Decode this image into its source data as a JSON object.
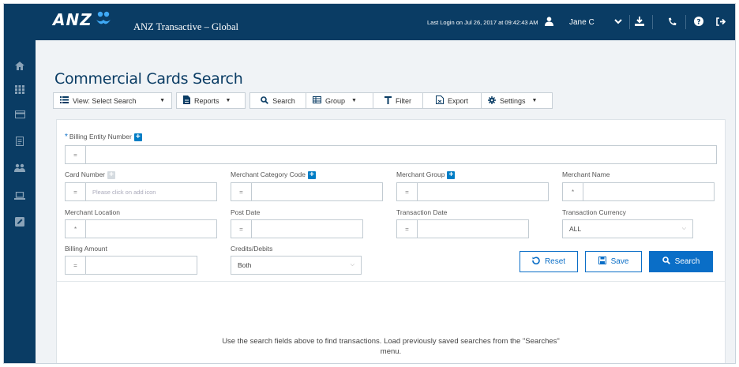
{
  "header": {
    "logo_text": "ANZ",
    "app_title": "ANZ Transactive – Global",
    "last_login": "Last Login on Jul 26, 2017 at 09:42:43 AM",
    "user_name": "Jane C"
  },
  "sidebar": {
    "items": [
      {
        "icon": "home-icon"
      },
      {
        "icon": "grid-icon"
      },
      {
        "icon": "card-icon"
      },
      {
        "icon": "document-icon"
      },
      {
        "icon": "users-icon"
      },
      {
        "icon": "laptop-icon"
      },
      {
        "icon": "edit-icon"
      }
    ]
  },
  "page": {
    "title": "Commercial Cards Search"
  },
  "toolbar": {
    "view_label": "View: Select Search",
    "reports_label": "Reports",
    "search_label": "Search",
    "group_label": "Group",
    "filter_label": "Filter",
    "export_label": "Export",
    "settings_label": "Settings"
  },
  "form": {
    "billing_entity_number_label": "Billing Entity Number",
    "billing_entity_number_op": "=",
    "card_number_label": "Card Number",
    "card_number_op": "=",
    "card_number_placeholder": "Please click on add icon",
    "merchant_category_code_label": "Merchant Category Code",
    "merchant_category_code_op": "=",
    "merchant_group_label": "Merchant Group",
    "merchant_group_op": "=",
    "merchant_name_label": "Merchant Name",
    "merchant_name_op": "*",
    "merchant_location_label": "Merchant Location",
    "merchant_location_op": "*",
    "post_date_label": "Post Date",
    "post_date_op": "=",
    "transaction_date_label": "Transaction Date",
    "transaction_date_op": "=",
    "transaction_currency_label": "Transaction Currency",
    "transaction_currency_value": "ALL",
    "billing_amount_label": "Billing Amount",
    "billing_amount_op": "=",
    "credits_debits_label": "Credits/Debits",
    "credits_debits_value": "Both"
  },
  "actions": {
    "reset_label": "Reset",
    "save_label": "Save",
    "search_label": "Search"
  },
  "results": {
    "empty_message": "Use the search fields above to find transactions. Load previously saved searches from the \"Searches\" menu."
  },
  "colors": {
    "brand_navy": "#0a3c64",
    "accent_blue": "#0a6ec7",
    "logo_blue": "#007dc5"
  }
}
